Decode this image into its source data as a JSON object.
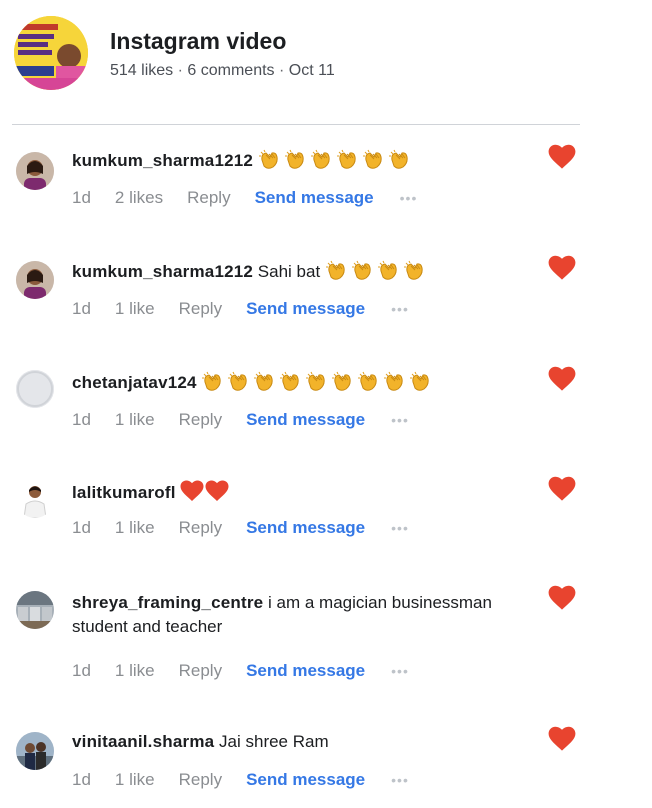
{
  "header": {
    "title": "Instagram video",
    "likes": "514 likes",
    "comments": "6 comments",
    "date": "Oct 11",
    "separator": "·"
  },
  "colors": {
    "heart": "#e8442f",
    "link": "#3578e5",
    "muted": "#8a8d91",
    "clap": "#f2b32a"
  },
  "comments": [
    {
      "username": "kumkum_sharma1212",
      "text": "",
      "emoji": "clapping-hands",
      "emoji_count": 6,
      "time": "1d",
      "likes": "2 likes",
      "reply": "Reply",
      "send": "Send message",
      "more": "•••",
      "liked": true
    },
    {
      "username": "kumkum_sharma1212",
      "text": "Sahi bat",
      "emoji": "clapping-hands",
      "emoji_count": 4,
      "time": "1d",
      "likes": "1 like",
      "reply": "Reply",
      "send": "Send message",
      "more": "•••",
      "liked": true
    },
    {
      "username": "chetanjatav124",
      "text": "",
      "emoji": "clapping-hands",
      "emoji_count": 9,
      "time": "1d",
      "likes": "1 like",
      "reply": "Reply",
      "send": "Send message",
      "more": "•••",
      "liked": true
    },
    {
      "username": "lalitkumarofl",
      "text": "",
      "emoji": "red-heart",
      "emoji_count": 2,
      "time": "1d",
      "likes": "1 like",
      "reply": "Reply",
      "send": "Send message",
      "more": "•••",
      "liked": true
    },
    {
      "username": "shreya_framing_centre",
      "text": "i am a magician businessman student and teacher",
      "emoji": "",
      "emoji_count": 0,
      "time": "1d",
      "likes": "1 like",
      "reply": "Reply",
      "send": "Send message",
      "more": "•••",
      "liked": true
    },
    {
      "username": "vinitaanil.sharma",
      "text": "Jai shree Ram",
      "emoji": "",
      "emoji_count": 0,
      "time": "1d",
      "likes": "1 like",
      "reply": "Reply",
      "send": "Send message",
      "more": "•••",
      "liked": true
    }
  ]
}
